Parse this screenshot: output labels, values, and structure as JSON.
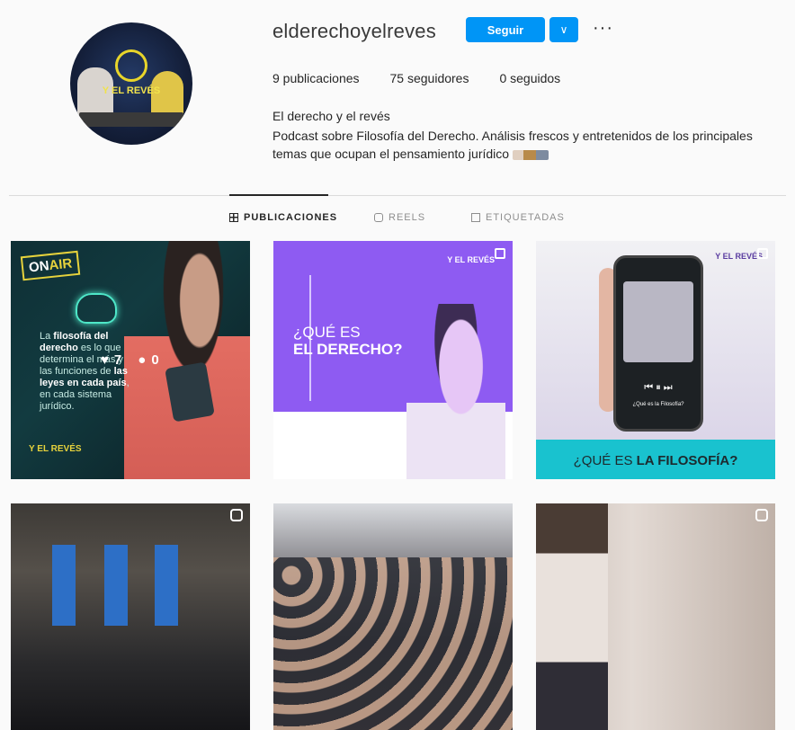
{
  "profile": {
    "username": "elderechoyelreves",
    "follow_label": "Seguir",
    "more_label": "···",
    "stats": {
      "posts": "9 publicaciones",
      "followers": "75 seguidores",
      "following": "0 seguidos"
    },
    "bio_name": "El derecho y el revés",
    "bio_text": "Podcast sobre Filosofía del Derecho. Análisis frescos y entretenidos de los principales temas que ocupan el pensamiento jurídico",
    "avatar_text": "Y EL REVÉS"
  },
  "tabs": [
    {
      "label": "PUBLICACIONES",
      "active": true
    },
    {
      "label": "REELS",
      "active": false
    },
    {
      "label": "ETIQUETADAS",
      "active": false
    }
  ],
  "posts": {
    "p1": {
      "on_air": "ON",
      "on_air_b": "AIR",
      "text_a": "La ",
      "text_b": "filosofía del derecho",
      "text_c": " es lo que determina el más y las funciones de ",
      "text_d": "las leyes en cada país",
      "text_e": ", en cada sistema jurídico.",
      "likes": "7",
      "comments": "0",
      "logo": "Y EL REVÉS"
    },
    "p2": {
      "q1": "¿QUÉ ES",
      "q2": "EL DERECHO?",
      "logo": "Y EL REVÉS"
    },
    "p3": {
      "caption_a": "¿QUÉ ES ",
      "caption_b": "LA FILOSOFÍA?",
      "logo": "Y EL REVÉS",
      "phone_title": "¿Qué es la Filosofía?",
      "controls": "⏮ ⏸ ⏭"
    }
  },
  "colors": {
    "accent": "#0095f6",
    "purple": "#8e5bf2",
    "teal": "#19c2cf"
  }
}
